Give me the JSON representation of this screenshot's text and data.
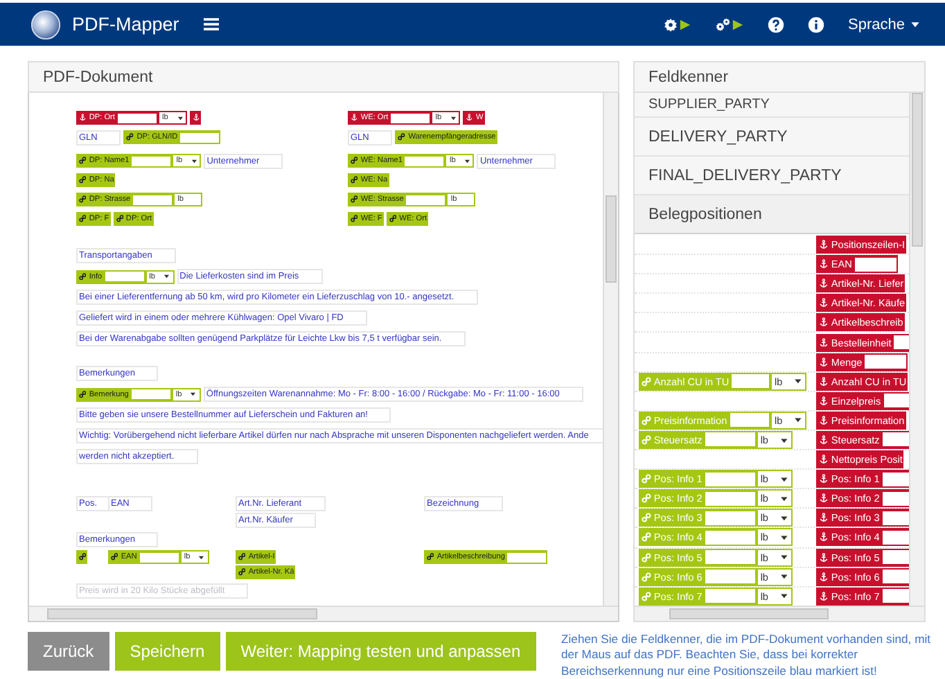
{
  "header": {
    "app_name": "PDF-Mapper",
    "language_menu": "Sprache"
  },
  "pdf_panel": {
    "title": "PDF-Dokument",
    "address_blocks": [
      {
        "groups": [
          [
            [
              {
                "kind": "anchor-tag",
                "label": "DP: Ort",
                "input": true,
                "unit": "lb",
                "dropdown": true
              },
              {
                "kind": "anchor-tag"
              }
            ],
            [
              {
                "kind": "text",
                "text": "GLN"
              },
              {
                "kind": "link-tag",
                "label": "DP: GLN/ID",
                "input": true
              }
            ]
          ],
          [
            [
              {
                "kind": "link-tag",
                "label": "DP: Name1",
                "input": true,
                "unit": "lb",
                "dropdown": true
              },
              {
                "kind": "text",
                "text": "Unternehmer"
              }
            ],
            [
              {
                "kind": "link-tag",
                "label": "DP: Na"
              }
            ],
            [
              {
                "kind": "link-tag",
                "label": "DP: Strasse",
                "input": true,
                "unit": "lb",
                "dropdown": false
              }
            ],
            [
              {
                "kind": "link-tag",
                "label": "DP: F"
              },
              {
                "kind": "link-tag",
                "label": "DP: Ort"
              }
            ]
          ]
        ]
      },
      {
        "groups": [
          [
            [
              {
                "kind": "anchor-tag",
                "label": "WE: Ort",
                "input": true,
                "unit": "lb",
                "dropdown": true
              },
              {
                "kind": "anchor-tag",
                "label": "W"
              }
            ],
            [
              {
                "kind": "text",
                "text": "GLN"
              },
              {
                "kind": "link-tag",
                "label": "Warenempfängeradresse"
              }
            ]
          ],
          [
            [
              {
                "kind": "link-tag",
                "label": "WE: Name1",
                "input": true,
                "unit": "lb",
                "dropdown": true
              },
              {
                "kind": "text",
                "text": "Unternehmer"
              }
            ],
            [
              {
                "kind": "link-tag",
                "label": "WE: Na"
              }
            ],
            [
              {
                "kind": "link-tag",
                "label": "WE: Strasse",
                "input": true,
                "unit": "lb",
                "dropdown": false
              }
            ],
            [
              {
                "kind": "link-tag",
                "label": "WE: F"
              },
              {
                "kind": "link-tag",
                "label": "WE: Ort"
              }
            ]
          ]
        ]
      }
    ],
    "sections": [
      [
        [
          {
            "kind": "text",
            "text": "Transportangaben"
          }
        ],
        [
          {
            "kind": "link-tag",
            "label": "Info",
            "input": true,
            "unit": "lb",
            "dropdown": true
          },
          {
            "kind": "text",
            "text": "Die Lieferkosten sind im Preis"
          }
        ],
        [
          {
            "kind": "text",
            "text": "Bei einer Lieferentfernung ab 50 km, wird pro Kilometer ein Lieferzuschlag von 10.- angesetzt."
          }
        ],
        [
          {
            "kind": "text",
            "text": "Geliefert wird in einem oder mehrere Kühlwagen: Opel Vivaro | FD"
          }
        ],
        [
          {
            "kind": "text",
            "text": "Bei der Warenabgabe sollten genügend Parkplätze für Leichte Lkw bis 7,5 t verfügbar sein."
          }
        ]
      ],
      [
        [
          {
            "kind": "text",
            "text": "Bemerkungen"
          }
        ],
        [
          {
            "kind": "link-tag",
            "label": "Bemerkung",
            "input": true,
            "unit": "lb",
            "dropdown": true
          },
          {
            "kind": "text",
            "text": "Öffnungszeiten Warenannahme: Mo - Fr: 8:00 - 16:00 / Rückgabe: Mo - Fr: 11:00 - 16:00"
          }
        ],
        [
          {
            "kind": "text",
            "text": "Bitte geben sie unsere Bestellnummer auf Lieferschein und Fakturen an!"
          }
        ],
        [
          {
            "kind": "text",
            "text": "Wichtig: Vorübergehend nicht lieferbare Artikel dürfen nur nach Absprache mit unseren Disponenten nachgeliefert werden. Ande"
          }
        ],
        [
          {
            "kind": "text",
            "text": "werden nicht akzeptiert."
          }
        ]
      ]
    ],
    "position_rows": [
      {
        "columns": [
          [
            {
              "kind": "text",
              "text": "Pos."
            }
          ],
          [
            {
              "kind": "text",
              "text": "EAN"
            }
          ],
          [
            {
              "kind": "text",
              "text": "Art.Nr. Lieferant"
            },
            {
              "kind": "text",
              "text": "Art.Nr. Käufer"
            }
          ],
          [
            {
              "kind": "text",
              "text": "Bezeichnung"
            }
          ]
        ]
      },
      {
        "items": [
          {
            "kind": "text",
            "text": "Bemerkungen"
          }
        ]
      },
      {
        "columns": [
          [
            {
              "kind": "link-tag"
            }
          ],
          [
            {
              "kind": "link-tag",
              "label": "EAN",
              "input": true,
              "unit": "lb",
              "dropdown": true
            }
          ],
          [
            {
              "kind": "link-tag",
              "label": "Artikel-I"
            },
            {
              "kind": "link-tag",
              "label": "Artikel-Nr. Kä"
            }
          ],
          [
            {
              "kind": "link-tag",
              "label": "Artikelbeschreibung",
              "input": true
            }
          ]
        ]
      },
      {
        "items": [
          {
            "kind": "hint-text",
            "text": "Preis wird in 20 Kilo Stücke abgefüllt"
          }
        ]
      }
    ]
  },
  "field_panel": {
    "title": "Feldkenner",
    "groups": [
      {
        "label": "SUPPLIER_PARTY",
        "expanded": false
      },
      {
        "label": "DELIVERY_PARTY",
        "expanded": false
      },
      {
        "label": "FINAL_DELIVERY_PARTY",
        "expanded": false
      },
      {
        "label": "Belegpositionen",
        "expanded": true
      }
    ],
    "rows": [
      {
        "anchor_tag": {
          "kind": "anchor-tag",
          "label": "Positionszeilen-I"
        }
      },
      {
        "anchor_tag": {
          "kind": "anchor-tag",
          "label": "EAN",
          "input": true
        }
      },
      {
        "anchor_tag": {
          "kind": "anchor-tag",
          "label": "Artikel-Nr. Liefer"
        }
      },
      {
        "anchor_tag": {
          "kind": "anchor-tag",
          "label": "Artikel-Nr. Käufe"
        }
      },
      {
        "anchor_tag": {
          "kind": "anchor-tag",
          "label": "Artikelbeschreib"
        }
      },
      {
        "anchor_tag": {
          "kind": "anchor-tag",
          "label": "Bestelleinheit",
          "input": true
        }
      },
      {
        "anchor_tag": {
          "kind": "anchor-tag",
          "label": "Menge",
          "input": true
        }
      },
      {
        "link_tag": {
          "kind": "link-tag",
          "label": "Anzahl CU in TU",
          "input": true,
          "unit": "lb",
          "dropdown": true
        },
        "anchor_tag": {
          "kind": "anchor-tag",
          "label": "Anzahl CU in TU"
        }
      },
      {
        "anchor_tag": {
          "kind": "anchor-tag",
          "label": "Einzelpreis",
          "input": true
        }
      },
      {
        "link_tag": {
          "kind": "link-tag",
          "label": "Preisinformation",
          "input": true,
          "unit": "lb",
          "dropdown": true
        },
        "anchor_tag": {
          "kind": "anchor-tag",
          "label": "Preisinformation"
        }
      },
      {
        "link_tag": {
          "kind": "link-tag",
          "label": "Steuersatz",
          "input": true,
          "unit": "lb",
          "dropdown": true
        },
        "anchor_tag": {
          "kind": "anchor-tag",
          "label": "Steuersatz",
          "input": true
        }
      },
      {
        "anchor_tag": {
          "kind": "anchor-tag",
          "label": "Nettopreis Posit"
        }
      },
      {
        "link_tag": {
          "kind": "link-tag",
          "label": "Pos: Info 1",
          "input": true,
          "unit": "lb",
          "dropdown": true
        },
        "anchor_tag": {
          "kind": "anchor-tag",
          "label": "Pos: Info 1",
          "input": true
        }
      },
      {
        "link_tag": {
          "kind": "link-tag",
          "label": "Pos: Info 2",
          "input": true,
          "unit": "lb",
          "dropdown": true
        },
        "anchor_tag": {
          "kind": "anchor-tag",
          "label": "Pos: Info 2",
          "input": true
        }
      },
      {
        "link_tag": {
          "kind": "link-tag",
          "label": "Pos: Info 3",
          "input": true,
          "unit": "lb",
          "dropdown": true
        },
        "anchor_tag": {
          "kind": "anchor-tag",
          "label": "Pos: Info 3",
          "input": true
        }
      },
      {
        "link_tag": {
          "kind": "link-tag",
          "label": "Pos: Info 4",
          "input": true,
          "unit": "lb",
          "dropdown": true
        },
        "anchor_tag": {
          "kind": "anchor-tag",
          "label": "Pos: Info 4",
          "input": true
        }
      },
      {
        "link_tag": {
          "kind": "link-tag",
          "label": "Pos: Info 5",
          "input": true,
          "unit": "lb",
          "dropdown": true
        },
        "anchor_tag": {
          "kind": "anchor-tag",
          "label": "Pos: Info 5",
          "input": true
        }
      },
      {
        "link_tag": {
          "kind": "link-tag",
          "label": "Pos: Info 6",
          "input": true,
          "unit": "lb",
          "dropdown": true
        },
        "anchor_tag": {
          "kind": "anchor-tag",
          "label": "Pos: Info 6",
          "input": true
        }
      },
      {
        "link_tag": {
          "kind": "link-tag",
          "label": "Pos: Info 7",
          "input": true,
          "unit": "lb",
          "dropdown": true
        },
        "anchor_tag": {
          "kind": "anchor-tag",
          "label": "Pos: Info 7",
          "input": true
        }
      }
    ]
  },
  "footer": {
    "buttons": [
      {
        "label": "Zurück",
        "kind": "secondary"
      },
      {
        "label": "Speichern",
        "kind": "primary"
      },
      {
        "label": "Weiter: Mapping testen und anpassen",
        "kind": "primary"
      }
    ],
    "help_text": "Ziehen Sie die Feldkenner, die im PDF-Dokument vorhanden sind, mit der Maus auf das PDF. Beachten Sie, dass bei korrekter Bereichserkennung nur eine Positionszeile blau markiert ist!"
  }
}
